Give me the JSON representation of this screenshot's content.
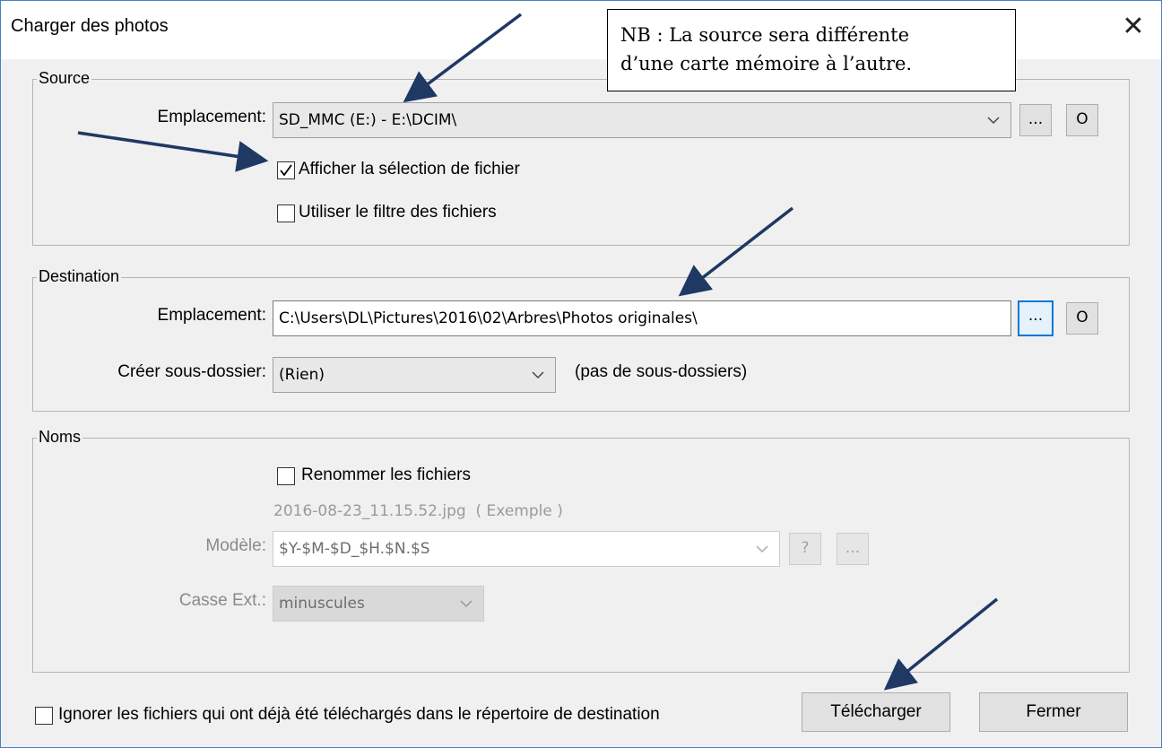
{
  "window": {
    "title": "Charger des photos",
    "close_glyph": "✕"
  },
  "source": {
    "legend": "Source",
    "location_label": "Emplacement:",
    "location_value": "SD_MMC (E:) - E:\\DCIM\\",
    "browse_label": "...",
    "open_label": "O",
    "show_selection_label": "Afficher la sélection de fichier",
    "show_selection_checked": true,
    "use_filter_label": "Utiliser le filtre des fichiers",
    "use_filter_checked": false
  },
  "destination": {
    "legend": "Destination",
    "location_label": "Emplacement:",
    "location_value": "C:\\Users\\DL\\Pictures\\2016\\02\\Arbres\\Photos originales\\",
    "browse_label": "...",
    "open_label": "O",
    "subfolder_label": "Créer sous-dossier:",
    "subfolder_value": "(Rien)",
    "subfolder_hint": "(pas de sous-dossiers)"
  },
  "names": {
    "legend": "Noms",
    "rename_label": "Renommer les fichiers",
    "rename_checked": false,
    "example": "2016-08-23_11.15.52.jpg  ( Exemple )",
    "model_label": "Modèle:",
    "model_value": "$Y-$M-$D_$H.$N.$S",
    "help_label": "?",
    "more_label": "...",
    "case_label": "Casse Ext.:",
    "case_value": "minuscules"
  },
  "footer": {
    "ignore_label": "Ignorer les fichiers qui ont déjà été téléchargés dans le répertoire de destination",
    "ignore_checked": false,
    "download_label": "Télécharger",
    "close_label": "Fermer"
  },
  "note": {
    "line1": "NB : La source sera différente",
    "line2": "d’une carte mémoire à l’autre."
  },
  "colors": {
    "arrow": "#1f3864",
    "focus": "#0078d7",
    "frame": "#4a7fbf"
  }
}
